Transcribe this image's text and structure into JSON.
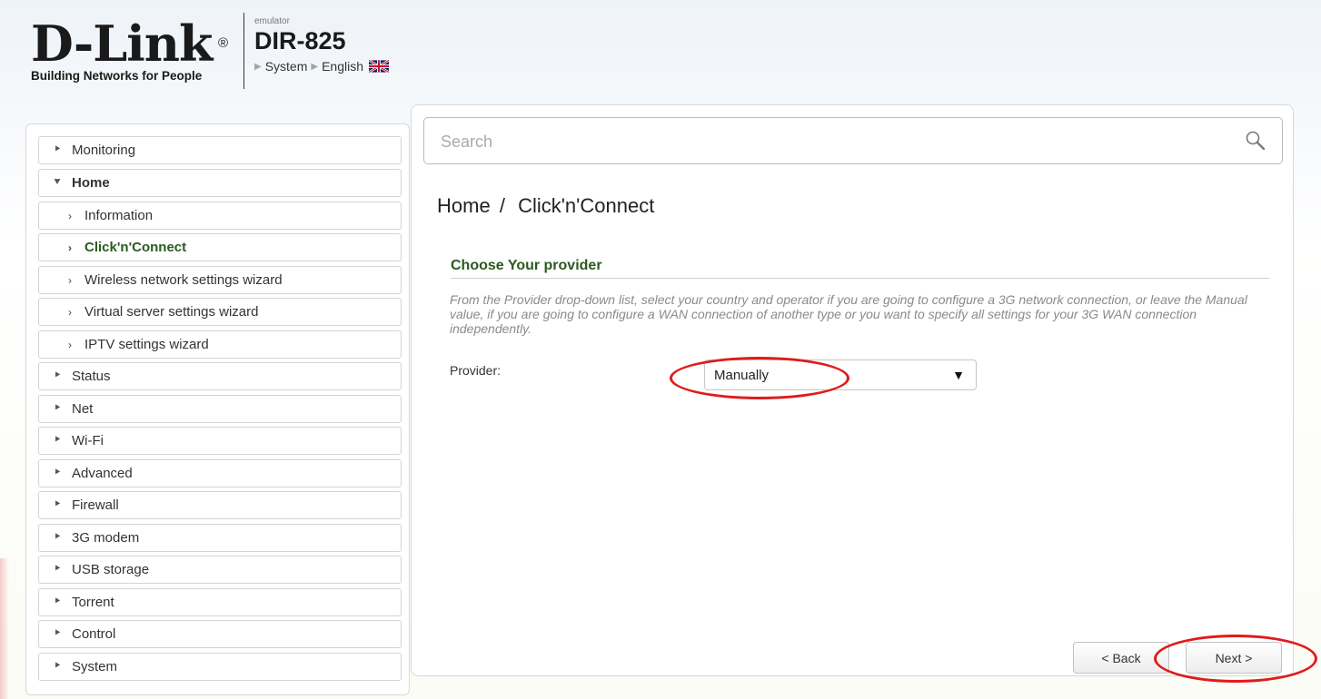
{
  "header": {
    "logo_text": "D-Link",
    "logo_reg": "®",
    "logo_tagline": "Building Networks for People",
    "emulator_label": "emulator",
    "model": "DIR-825",
    "nav_system": "System",
    "nav_language": "English",
    "flag_icon": "uk-flag-icon"
  },
  "sidebar": {
    "items": [
      {
        "label": "Monitoring",
        "icon": "chevron-right-icon"
      },
      {
        "label": "Home",
        "icon": "chevron-down-icon"
      },
      {
        "label": "Information",
        "icon": "arrow-right-icon"
      },
      {
        "label": "Click'n'Connect",
        "icon": "arrow-right-icon"
      },
      {
        "label": "Wireless network settings wizard",
        "icon": "arrow-right-icon"
      },
      {
        "label": "Virtual server settings wizard",
        "icon": "arrow-right-icon"
      },
      {
        "label": "IPTV settings wizard",
        "icon": "arrow-right-icon"
      },
      {
        "label": "Status",
        "icon": "chevron-right-icon"
      },
      {
        "label": "Net",
        "icon": "chevron-right-icon"
      },
      {
        "label": "Wi-Fi",
        "icon": "chevron-right-icon"
      },
      {
        "label": "Advanced",
        "icon": "chevron-right-icon"
      },
      {
        "label": "Firewall",
        "icon": "chevron-right-icon"
      },
      {
        "label": "3G modem",
        "icon": "chevron-right-icon"
      },
      {
        "label": "USB storage",
        "icon": "chevron-right-icon"
      },
      {
        "label": "Torrent",
        "icon": "chevron-right-icon"
      },
      {
        "label": "Control",
        "icon": "chevron-right-icon"
      },
      {
        "label": "System",
        "icon": "chevron-right-icon"
      }
    ]
  },
  "main": {
    "search": {
      "placeholder": "Search",
      "value": ""
    },
    "breadcrumb": {
      "parent": "Home",
      "separator": "/",
      "current": "Click'n'Connect"
    },
    "section_title": "Choose Your provider",
    "description": "From the Provider drop-down list, select your country and operator if you are going to configure a 3G network connection, or leave the Manual value, if you are going to configure a WAN connection of another type or you want to specify all settings for your 3G WAN connection independently.",
    "provider_label": "Provider:",
    "provider_value": "Manually",
    "back_label": "< Back",
    "next_label": "Next >"
  },
  "colors": {
    "accent_green": "#2b5a1e",
    "highlight_red": "#e01b1b"
  }
}
